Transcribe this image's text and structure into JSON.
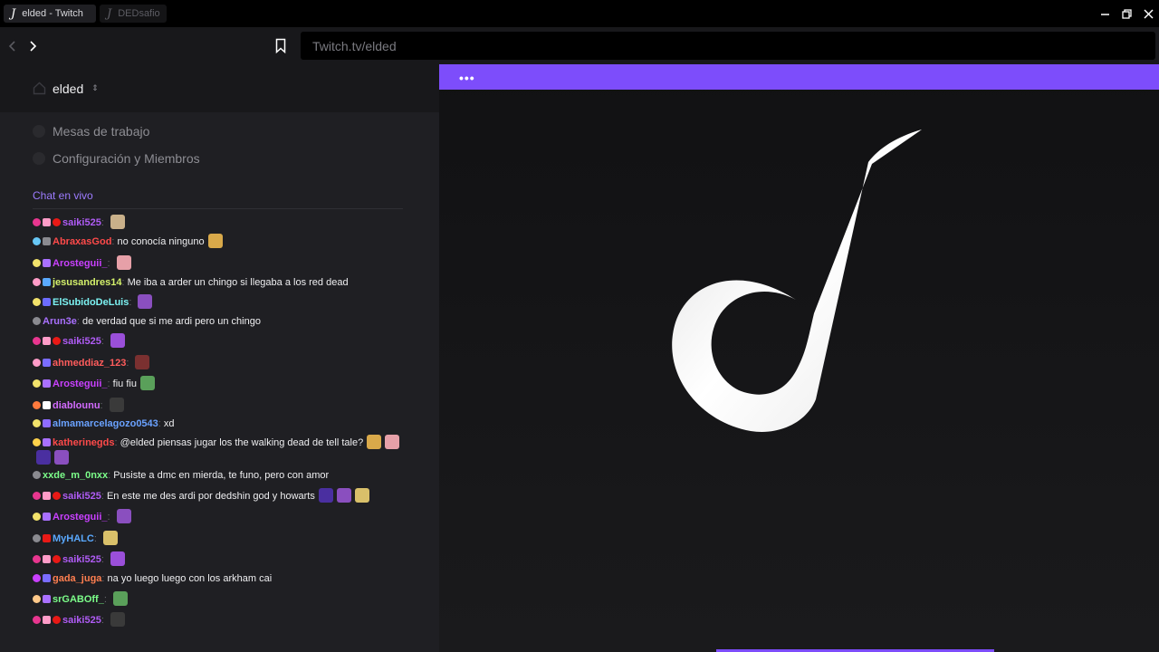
{
  "tabs": [
    {
      "label": "elded - Twitch",
      "active": true
    },
    {
      "label": "DEDsafio",
      "active": false
    }
  ],
  "address_bar": {
    "url": "Twitch.tv/elded"
  },
  "sidebar": {
    "channel": "elded",
    "menu": [
      {
        "label": "Mesas de trabajo"
      },
      {
        "label": "Configuración y Miembros"
      }
    ],
    "chat_title": "Chat en vivo"
  },
  "chat": [
    {
      "user": "saiki525",
      "color": "#b05cf6",
      "text": "",
      "badges": [
        "#e8368f",
        "#ff9cc8",
        "#e91916"
      ],
      "emotes": 1
    },
    {
      "user": "AbraxasGod",
      "color": "#ff4a4a",
      "text": "no conocía ninguno",
      "badges": [
        "#67c7f5",
        "#8a8a90"
      ],
      "emotes": 1
    },
    {
      "user": "Arosteguii_",
      "color": "#c940ff",
      "text": "",
      "badges": [
        "#f2e26b",
        "#a970ff"
      ],
      "emotes": 1
    },
    {
      "user": "jesusandres14",
      "color": "#d4f16b",
      "text": "Me iba a arder un chingo si llegaba a los red dead",
      "badges": [
        "#ff9cc8",
        "#5aa9ff"
      ],
      "emotes": 0
    },
    {
      "user": "ElSubidoDeLuis",
      "color": "#7cf2f2",
      "text": "",
      "badges": [
        "#f2e26b",
        "#6c6cff"
      ],
      "emotes": 1
    },
    {
      "user": "Arun3e",
      "color": "#a970ff",
      "text": "de verdad que si me ardi pero un chingo",
      "badges": [
        "#8a8a90"
      ],
      "emotes": 0
    },
    {
      "user": "saiki525",
      "color": "#b05cf6",
      "text": "",
      "badges": [
        "#e8368f",
        "#ff9cc8",
        "#e91916"
      ],
      "emotes": 1
    },
    {
      "user": "ahmeddiaz_123",
      "color": "#ff5c5c",
      "text": "",
      "badges": [
        "#ff9cc8",
        "#7a6cff"
      ],
      "emotes": 1
    },
    {
      "user": "Arosteguii_",
      "color": "#c940ff",
      "text": "fiu fiu",
      "badges": [
        "#f2e26b",
        "#a970ff"
      ],
      "emotes": 1
    },
    {
      "user": "diablounu",
      "color": "#d36bff",
      "text": "",
      "badges": [
        "#ff7a3d",
        "#ffffff"
      ],
      "emotes": 1
    },
    {
      "user": "almamarcelagozo0543",
      "color": "#6aa2ff",
      "text": "xd",
      "badges": [
        "#f2e26b",
        "#8e6cff"
      ],
      "emotes": 0
    },
    {
      "user": "katherinegds",
      "color": "#ff4a4a",
      "text": "@elded piensas jugar los the walking dead de tell tale?",
      "badges": [
        "#ffd24a",
        "#a970ff"
      ],
      "emotes": 4
    },
    {
      "user": "xxde_m_0nxx",
      "color": "#7cff8a",
      "text": "Pusiste a dmc en mierda, te funo, pero con amor",
      "badges": [
        "#8a8a90"
      ],
      "emotes": 0
    },
    {
      "user": "saiki525",
      "color": "#b05cf6",
      "text": "En este me des ardi por dedshin god y howarts",
      "badges": [
        "#e8368f",
        "#ff9cc8",
        "#e91916"
      ],
      "emotes": 3
    },
    {
      "user": "Arosteguii_",
      "color": "#c940ff",
      "text": "",
      "badges": [
        "#f2e26b",
        "#a970ff"
      ],
      "emotes": 1
    },
    {
      "user": "MyHALC",
      "color": "#5aa9ff",
      "text": "",
      "badges": [
        "#8a8a90",
        "#e91916"
      ],
      "emotes": 1
    },
    {
      "user": "saiki525",
      "color": "#b05cf6",
      "text": "",
      "badges": [
        "#e8368f",
        "#ff9cc8",
        "#e91916"
      ],
      "emotes": 1
    },
    {
      "user": "gada_juga",
      "color": "#ff7f50",
      "text": "na yo luego luego con los arkham cai",
      "badges": [
        "#c940ff",
        "#7a6cff"
      ],
      "emotes": 0
    },
    {
      "user": "srGABOff_",
      "color": "#7cff8a",
      "text": "",
      "badges": [
        "#ffc98a",
        "#a970ff"
      ],
      "emotes": 1
    },
    {
      "user": "saiki525",
      "color": "#b05cf6",
      "text": "",
      "badges": [
        "#e8368f",
        "#ff9cc8",
        "#e91916"
      ],
      "emotes": 1
    }
  ],
  "colors": {
    "accent": "#7d4dfb",
    "chat_title": "#9d7cff"
  }
}
